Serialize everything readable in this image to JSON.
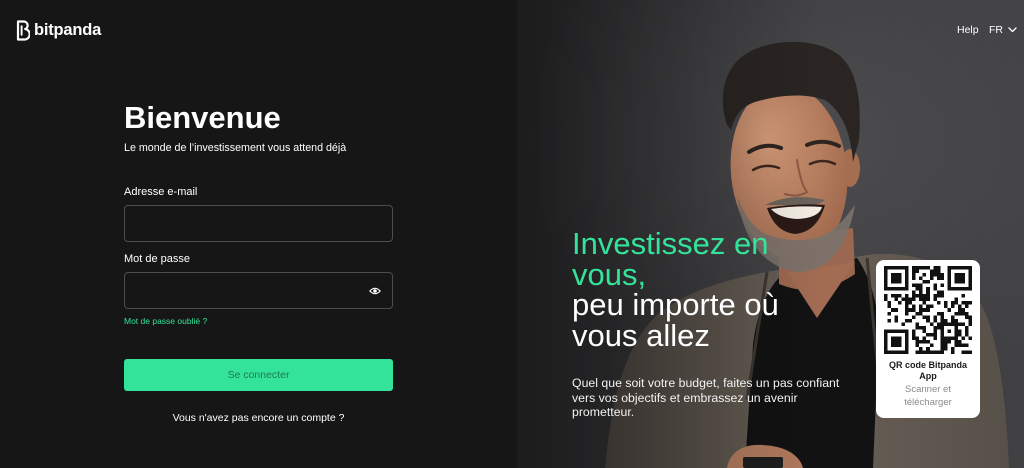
{
  "app": {
    "brand_name": "bitpanda"
  },
  "header": {
    "help_label": "Help",
    "language_label": "FR"
  },
  "login": {
    "title": "Bienvenue",
    "subtitle": "Le monde de l’investissement vous attend déjà",
    "email": {
      "label": "Adresse e-mail",
      "value": ""
    },
    "password": {
      "label": "Mot de passe",
      "value": ""
    },
    "forgot_password_label": "Mot de passe oublié ?",
    "submit_label": "Se connecter",
    "signup_prompt": "Vous n'avez pas encore un compte ?"
  },
  "hero": {
    "headline_highlight": [
      "Investissez en",
      "vous,"
    ],
    "headline_rest": [
      "peu importe où",
      "vous allez"
    ],
    "description": "Quel que soit votre budget, faites un pas confiant vers vos objectifs et embrassez un avenir prometteur."
  },
  "qr_card": {
    "title": "QR code Bitpanda App",
    "subtitle": "Scanner et télécharger"
  },
  "icons": {
    "logo": "bitpanda-logo-icon",
    "password_toggle": "eye-icon",
    "language_toggle": "chevron-down-icon",
    "qr": "qr-code"
  },
  "colors": {
    "accent": "#34e39a",
    "login_background": "#161616",
    "hero_background": "#3a3a3c",
    "button_text": "#1f7a52",
    "card_background": "#ffffff"
  }
}
